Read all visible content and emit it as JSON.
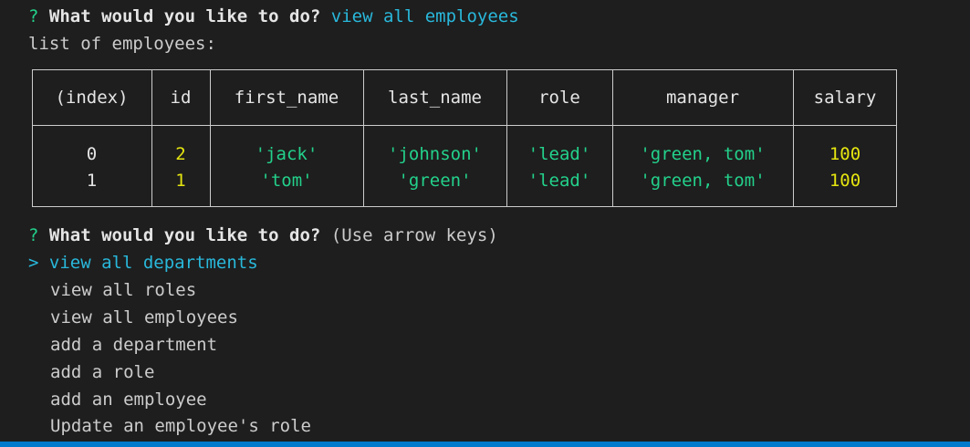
{
  "prompt1": {
    "marker": "?",
    "question": "What would you like to do?",
    "answer": "view all employees"
  },
  "list_label": "list of employees:",
  "table": {
    "headers": [
      "(index)",
      "id",
      "first_name",
      "last_name",
      "role",
      "manager",
      "salary"
    ],
    "rows": [
      [
        "0",
        "2",
        "'jack'",
        "'johnson'",
        "'lead'",
        "'green, tom'",
        "100"
      ],
      [
        "1",
        "1",
        "'tom'",
        "'green'",
        "'lead'",
        "'green, tom'",
        "100"
      ]
    ]
  },
  "prompt2": {
    "marker": "?",
    "question": "What would you like to do?",
    "hint": "(Use arrow keys)"
  },
  "menu": {
    "pointer": ">",
    "items": [
      "view all departments",
      "view all roles",
      "view all employees",
      "add a department",
      "add a role",
      "add an employee",
      "Update an employee's role"
    ],
    "selected_index": 0
  },
  "colors": {
    "background": "#1e1e1e",
    "green": "#23d18b",
    "cyan": "#29b8db",
    "yellow": "#e5e510",
    "statusbar": "#007acc"
  }
}
